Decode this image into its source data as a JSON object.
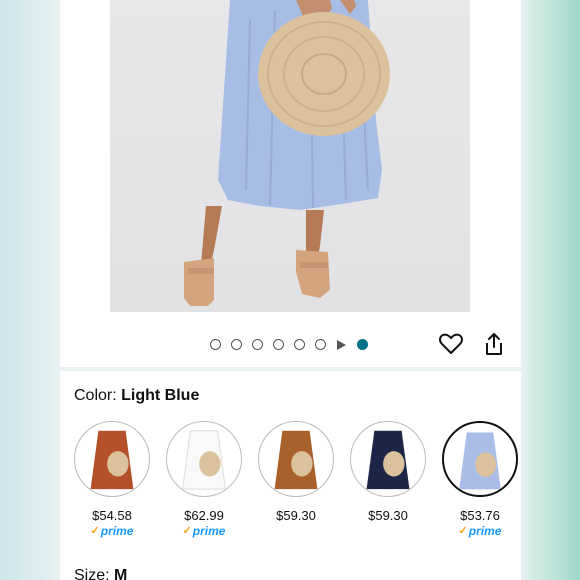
{
  "product": {
    "image_alt": "Woman in light blue pleated midi dress holding straw hat",
    "carousel": {
      "count": 8,
      "active_index": 7,
      "video_index": 6
    }
  },
  "actions": {
    "heart_icon": "heart-icon",
    "share_icon": "share-icon"
  },
  "color": {
    "label": "Color: ",
    "selected_value": "Light Blue",
    "options": [
      {
        "name": "Rust",
        "price": "$54.58",
        "prime": true,
        "dress_color": "#b4512a"
      },
      {
        "name": "White",
        "price": "$62.99",
        "prime": true,
        "dress_color": "#f7f7f7"
      },
      {
        "name": "Brown",
        "price": "$59.30",
        "prime": false,
        "dress_color": "#a8612a"
      },
      {
        "name": "Navy",
        "price": "$59.30",
        "prime": false,
        "dress_color": "#1d2647"
      },
      {
        "name": "Light Blue",
        "price": "$53.76",
        "prime": true,
        "dress_color": "#a9bde6",
        "selected": true
      }
    ]
  },
  "prime_label": "prime",
  "size": {
    "label": "Size: ",
    "value": "M"
  },
  "colors": {
    "accent": "#007185",
    "prime_blue": "#1a98ff",
    "prime_check": "#f7a21b"
  }
}
